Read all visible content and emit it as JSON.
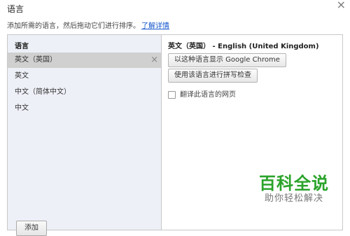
{
  "dialog": {
    "title": "语言",
    "close_icon": "×",
    "subtitle": "添加所需的语言，然后拖动它们进行排序。",
    "learn_more": "了解详情"
  },
  "languages": {
    "header": "语言",
    "items": [
      {
        "label": "英文（英国）",
        "selected": true
      },
      {
        "label": "英文",
        "selected": false
      },
      {
        "label": "中文（简体中文）",
        "selected": false
      },
      {
        "label": "中文",
        "selected": false
      }
    ],
    "remove_icon": "×",
    "add_button": "添加"
  },
  "details": {
    "title": "英文（英国） - English (United Kingdom)",
    "display_button": "以这种语言显示 Google Chrome",
    "spellcheck_button": "使用该语言进行拼写检查",
    "translate_checkbox": "翻译此语言的网页"
  },
  "watermark": {
    "main": "百科全说",
    "sub": "助你轻松解决"
  }
}
